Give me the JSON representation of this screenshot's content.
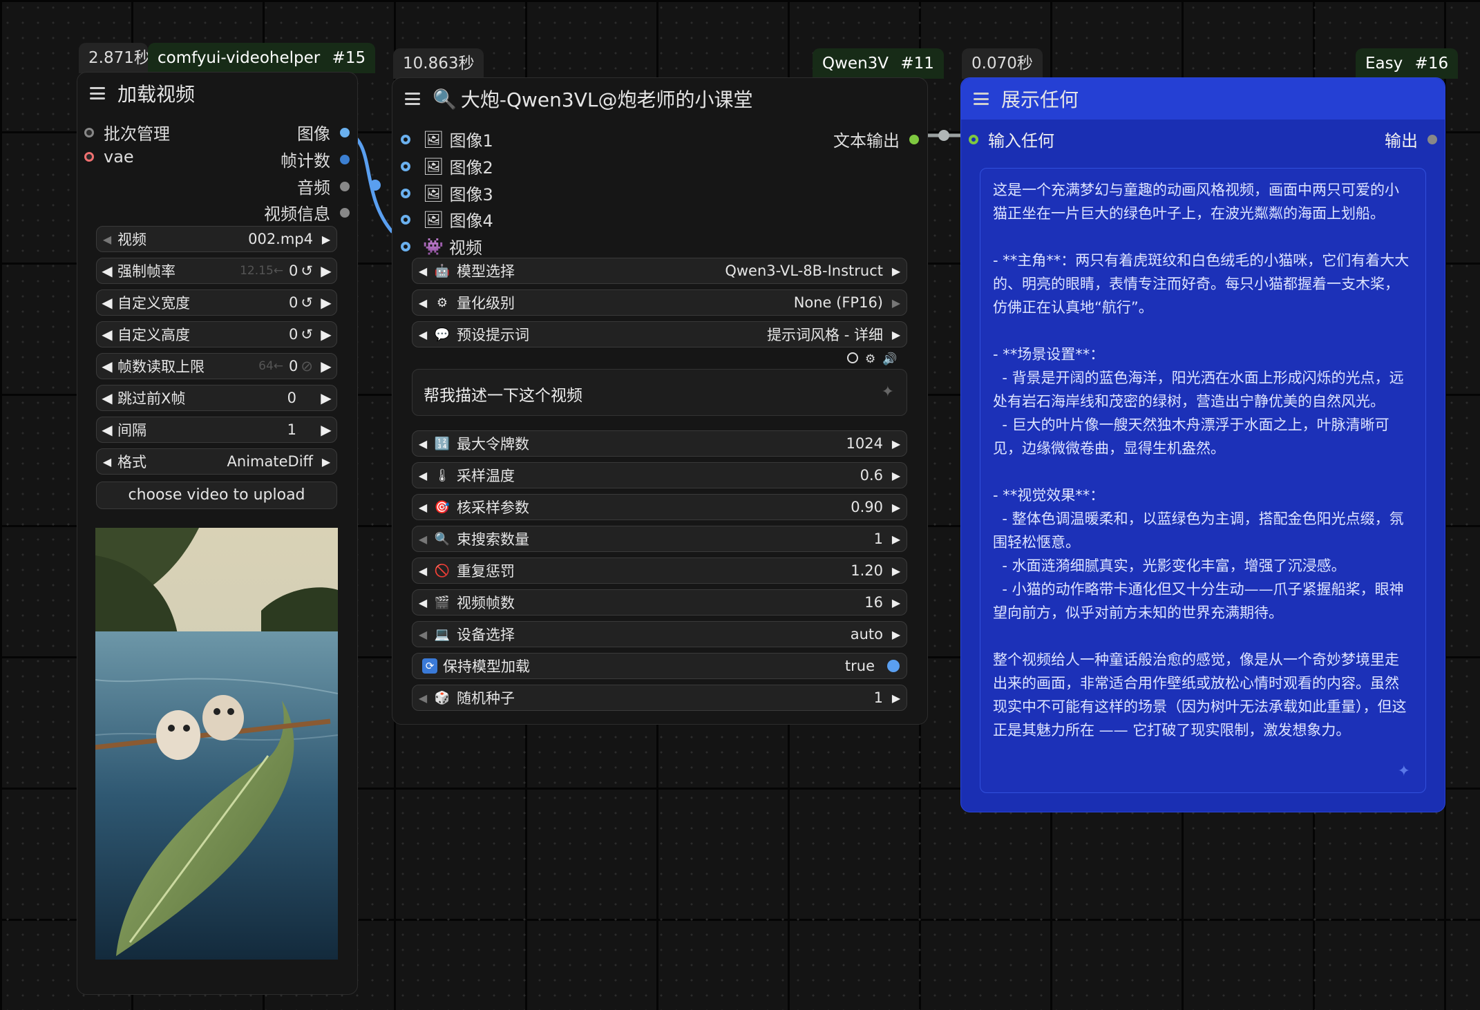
{
  "colors": {
    "canvas": "#141414",
    "node_bg": "#161616",
    "blue_node_bg": "#1a2fb3",
    "blue_header": "#2540d4",
    "link_blue": "#5a9ff0",
    "port_image": "#6ab0ee",
    "port_vae": "#f07070",
    "port_output": "#7ec840"
  },
  "video_node": {
    "time": "2.871秒",
    "badge": "comfyui-videohelper",
    "id": "#15",
    "title": "加载视频",
    "inputs": [
      "批次管理",
      "vae"
    ],
    "outputs": [
      "图像",
      "帧计数",
      "音频",
      "视频信息"
    ],
    "widgets": [
      {
        "label": "视频",
        "value": "002.mp4",
        "ghost": "",
        "suffix": ""
      },
      {
        "label": "强制帧率",
        "value": "0",
        "ghost": "12.15←",
        "suffix": "↺"
      },
      {
        "label": "自定义宽度",
        "value": "0",
        "ghost": "",
        "suffix": "↺"
      },
      {
        "label": "自定义高度",
        "value": "0",
        "ghost": "",
        "suffix": "↺"
      },
      {
        "label": "帧数读取上限",
        "value": "0",
        "ghost": "64←",
        "suffix": "⊘"
      },
      {
        "label": "跳过前X帧",
        "value": "0",
        "ghost": "",
        "suffix": ""
      },
      {
        "label": "间隔",
        "value": "1",
        "ghost": "",
        "suffix": ""
      },
      {
        "label": "格式",
        "value": "AnimateDiff",
        "ghost": "",
        "suffix": ""
      }
    ],
    "upload_label": "choose video to upload",
    "preview_icon": "kitten-leaf-boat-preview"
  },
  "qwen_node": {
    "time": "10.863秒",
    "badge": "Qwen3V",
    "id": "#11",
    "title": "大炮-Qwen3VL@炮老师的小课堂",
    "title_icon": "magnifier-icon",
    "inputs": [
      {
        "label": "图像1",
        "icon": "image-icon"
      },
      {
        "label": "图像2",
        "icon": "image-icon"
      },
      {
        "label": "图像3",
        "icon": "image-icon"
      },
      {
        "label": "图像4",
        "icon": "image-icon"
      },
      {
        "label": "视频",
        "icon": "video-icon"
      }
    ],
    "output": "文本输出",
    "selects": [
      {
        "label": "模型选择",
        "value": "Qwen3-VL-8B-Instruct",
        "icon": "robot-icon",
        "glyph": "🤖"
      },
      {
        "label": "量化级别",
        "value": "None (FP16)",
        "icon": "gear-icon",
        "glyph": "⚙"
      },
      {
        "label": "预设提示词",
        "value": "提示词风格 - 详细",
        "icon": "speech-bubble-icon",
        "glyph": "💬"
      }
    ],
    "prompt": "帮我描述一下这个视频",
    "params": [
      {
        "label": "最大令牌数",
        "value": "1024",
        "icon": "numbers-icon",
        "glyph": "🔢"
      },
      {
        "label": "采样温度",
        "value": "0.6",
        "icon": "thermometer-icon",
        "glyph": "🌡"
      },
      {
        "label": "核采样参数",
        "value": "0.90",
        "icon": "target-icon",
        "glyph": "🎯"
      },
      {
        "label": "束搜索数量",
        "value": "1",
        "icon": "search-icon",
        "glyph": "🔍"
      },
      {
        "label": "重复惩罚",
        "value": "1.20",
        "icon": "prohibited-icon",
        "glyph": "🚫"
      },
      {
        "label": "视频帧数",
        "value": "16",
        "icon": "clapper-icon",
        "glyph": "🎬"
      },
      {
        "label": "设备选择",
        "value": "auto",
        "icon": "laptop-icon",
        "glyph": "💻"
      }
    ],
    "toggle": {
      "label": "保持模型加载",
      "value": "true",
      "icon": "refresh-icon"
    },
    "seed": {
      "label": "随机种子",
      "value": "1",
      "icon": "dice-icon",
      "glyph": "🎲"
    }
  },
  "show_node": {
    "time": "0.070秒",
    "badge": "Easy",
    "id": "#16",
    "title": "展示任何",
    "input": "输入任何",
    "output": "输出",
    "text": "这是一个充满梦幻与童趣的动画风格视频，画面中两只可爱的小猫正坐在一片巨大的绿色叶子上，在波光粼粼的海面上划船。\n\n- **主角**：两只有着虎斑纹和白色绒毛的小猫咪，它们有着大大的、明亮的眼睛，表情专注而好奇。每只小猫都握着一支木桨，仿佛正在认真地“航行”。\n\n- **场景设置**：\n  - 背景是开阔的蓝色海洋，阳光洒在水面上形成闪烁的光点，远处有岩石海岸线和茂密的绿树，营造出宁静优美的自然风光。\n  - 巨大的叶片像一艘天然独木舟漂浮于水面之上，叶脉清晰可见，边缘微微卷曲，显得生机盎然。\n\n- **视觉效果**：\n  - 整体色调温暖柔和，以蓝绿色为主调，搭配金色阳光点缀，氛围轻松惬意。\n  - 水面涟漪细腻真实，光影变化丰富，增强了沉浸感。\n  - 小猫的动作略带卡通化但又十分生动——爪子紧握船桨，眼神望向前方，似乎对前方未知的世界充满期待。\n\n整个视频给人一种童话般治愈的感觉，像是从一个奇妙梦境里走出来的画面，非常适合用作壁纸或放松心情时观看的内容。虽然现实中不可能有这样的场景（因为树叶无法承载如此重量），但这正是其魅力所在 —— 它打破了现实限制，激发想象力。"
  }
}
